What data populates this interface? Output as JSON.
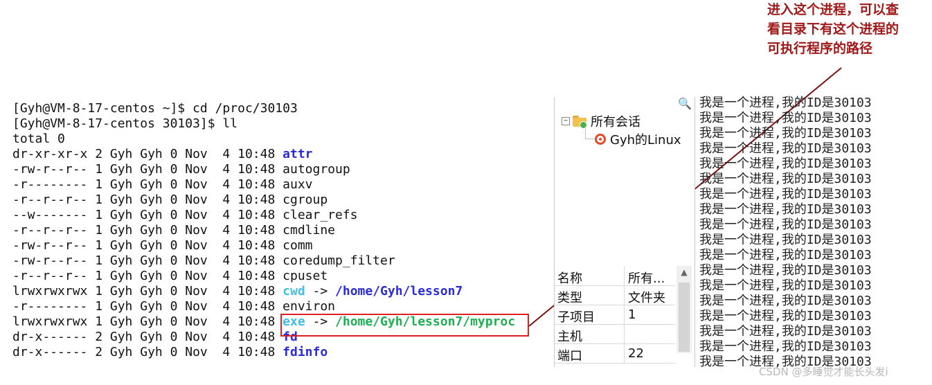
{
  "annotation": {
    "lines": [
      "进入这个进程，可以查",
      "看目录下有这个进程的",
      "可执行程序的路径"
    ],
    "color": "#a01818"
  },
  "terminal": {
    "lines": [
      {
        "prefix": "[Gyh@VM-8-17-centos ~]$ cd /proc/30103",
        "name": "",
        "arrow": "",
        "target": "",
        "name_color": "",
        "target_color": ""
      },
      {
        "prefix": "[Gyh@VM-8-17-centos 30103]$ ll",
        "name": "",
        "arrow": "",
        "target": "",
        "name_color": "",
        "target_color": ""
      },
      {
        "prefix": "total 0",
        "name": "",
        "arrow": "",
        "target": "",
        "name_color": "",
        "target_color": ""
      },
      {
        "prefix": "dr-xr-xr-x 2 Gyh Gyh 0 Nov  4 10:48 ",
        "name": "attr",
        "arrow": "",
        "target": "",
        "name_color": "#2b2bd8",
        "target_color": ""
      },
      {
        "prefix": "-rw-r--r-- 1 Gyh Gyh 0 Nov  4 10:48 ",
        "name": "autogroup",
        "arrow": "",
        "target": "",
        "name_color": "",
        "target_color": ""
      },
      {
        "prefix": "-r-------- 1 Gyh Gyh 0 Nov  4 10:48 ",
        "name": "auxv",
        "arrow": "",
        "target": "",
        "name_color": "",
        "target_color": ""
      },
      {
        "prefix": "-r--r--r-- 1 Gyh Gyh 0 Nov  4 10:48 ",
        "name": "cgroup",
        "arrow": "",
        "target": "",
        "name_color": "",
        "target_color": ""
      },
      {
        "prefix": "--w------- 1 Gyh Gyh 0 Nov  4 10:48 ",
        "name": "clear_refs",
        "arrow": "",
        "target": "",
        "name_color": "",
        "target_color": ""
      },
      {
        "prefix": "-r--r--r-- 1 Gyh Gyh 0 Nov  4 10:48 ",
        "name": "cmdline",
        "arrow": "",
        "target": "",
        "name_color": "",
        "target_color": ""
      },
      {
        "prefix": "-rw-r--r-- 1 Gyh Gyh 0 Nov  4 10:48 ",
        "name": "comm",
        "arrow": "",
        "target": "",
        "name_color": "",
        "target_color": ""
      },
      {
        "prefix": "-rw-r--r-- 1 Gyh Gyh 0 Nov  4 10:48 ",
        "name": "coredump_filter",
        "arrow": "",
        "target": "",
        "name_color": "",
        "target_color": ""
      },
      {
        "prefix": "-r--r--r-- 1 Gyh Gyh 0 Nov  4 10:48 ",
        "name": "cpuset",
        "arrow": "",
        "target": "",
        "name_color": "",
        "target_color": ""
      },
      {
        "prefix": "lrwxrwxrwx 1 Gyh Gyh 0 Nov  4 10:48 ",
        "name": "cwd",
        "arrow": " -> ",
        "target": "/home/Gyh/lesson7",
        "name_color": "#3cc0e8",
        "target_color": "#2b2bd8"
      },
      {
        "prefix": "-r-------- 1 Gyh Gyh 0 Nov  4 10:48 ",
        "name": "environ",
        "arrow": "",
        "target": "",
        "name_color": "",
        "target_color": ""
      },
      {
        "prefix": "lrwxrwxrwx 1 Gyh Gyh 0 Nov  4 10:48 ",
        "name": "exe",
        "arrow": " -> ",
        "target": "/home/Gyh/lesson7/myproc",
        "name_color": "#3cc0e8",
        "target_color": "#1fae52"
      },
      {
        "prefix": "dr-x------ 2 Gyh Gyh 0 Nov  4 10:48 ",
        "name": "fd",
        "arrow": "",
        "target": "",
        "name_color": "#2b2bd8",
        "target_color": ""
      },
      {
        "prefix": "dr-x------ 2 Gyh Gyh 0 Nov  4 10:48 ",
        "name": "fdinfo",
        "arrow": "",
        "target": "",
        "name_color": "#2b2bd8",
        "target_color": ""
      }
    ]
  },
  "session_tree": {
    "toggle": "−",
    "root_label": "所有会话",
    "child_label": "Gyh的Linux"
  },
  "properties": {
    "rows": [
      {
        "key": "名称",
        "value": "所有..."
      },
      {
        "key": "类型",
        "value": "文件夹"
      },
      {
        "key": "子项目",
        "value": "1"
      },
      {
        "key": "主机",
        "value": ""
      },
      {
        "key": "端口",
        "value": "22"
      }
    ]
  },
  "output": {
    "line_text": "我是一个进程,我的ID是30103",
    "line_count": 18
  },
  "watermark": "CSDN @多睡觉才能长头发i"
}
